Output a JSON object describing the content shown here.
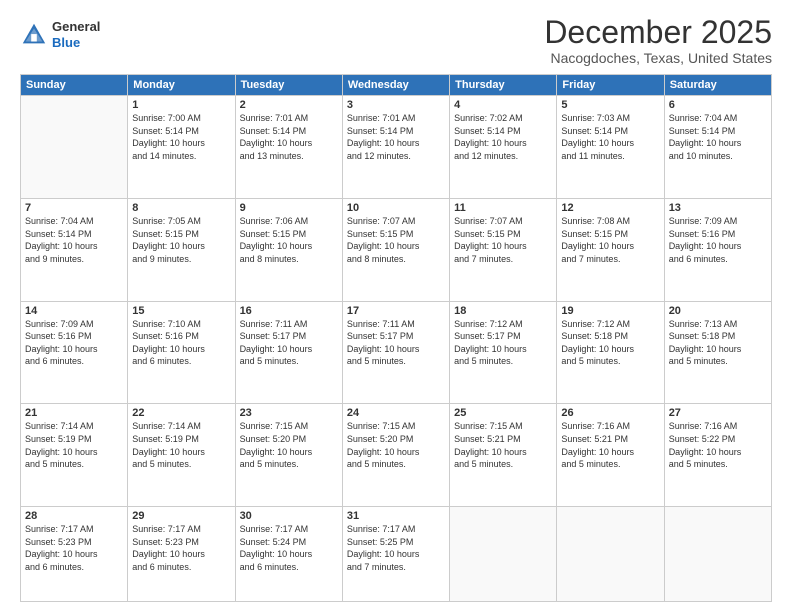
{
  "logo": {
    "general": "General",
    "blue": "Blue"
  },
  "header": {
    "month": "December 2025",
    "location": "Nacogdoches, Texas, United States"
  },
  "days_of_week": [
    "Sunday",
    "Monday",
    "Tuesday",
    "Wednesday",
    "Thursday",
    "Friday",
    "Saturday"
  ],
  "weeks": [
    [
      {
        "day": "",
        "info": ""
      },
      {
        "day": "1",
        "info": "Sunrise: 7:00 AM\nSunset: 5:14 PM\nDaylight: 10 hours\nand 14 minutes."
      },
      {
        "day": "2",
        "info": "Sunrise: 7:01 AM\nSunset: 5:14 PM\nDaylight: 10 hours\nand 13 minutes."
      },
      {
        "day": "3",
        "info": "Sunrise: 7:01 AM\nSunset: 5:14 PM\nDaylight: 10 hours\nand 12 minutes."
      },
      {
        "day": "4",
        "info": "Sunrise: 7:02 AM\nSunset: 5:14 PM\nDaylight: 10 hours\nand 12 minutes."
      },
      {
        "day": "5",
        "info": "Sunrise: 7:03 AM\nSunset: 5:14 PM\nDaylight: 10 hours\nand 11 minutes."
      },
      {
        "day": "6",
        "info": "Sunrise: 7:04 AM\nSunset: 5:14 PM\nDaylight: 10 hours\nand 10 minutes."
      }
    ],
    [
      {
        "day": "7",
        "info": "Sunrise: 7:04 AM\nSunset: 5:14 PM\nDaylight: 10 hours\nand 9 minutes."
      },
      {
        "day": "8",
        "info": "Sunrise: 7:05 AM\nSunset: 5:15 PM\nDaylight: 10 hours\nand 9 minutes."
      },
      {
        "day": "9",
        "info": "Sunrise: 7:06 AM\nSunset: 5:15 PM\nDaylight: 10 hours\nand 8 minutes."
      },
      {
        "day": "10",
        "info": "Sunrise: 7:07 AM\nSunset: 5:15 PM\nDaylight: 10 hours\nand 8 minutes."
      },
      {
        "day": "11",
        "info": "Sunrise: 7:07 AM\nSunset: 5:15 PM\nDaylight: 10 hours\nand 7 minutes."
      },
      {
        "day": "12",
        "info": "Sunrise: 7:08 AM\nSunset: 5:15 PM\nDaylight: 10 hours\nand 7 minutes."
      },
      {
        "day": "13",
        "info": "Sunrise: 7:09 AM\nSunset: 5:16 PM\nDaylight: 10 hours\nand 6 minutes."
      }
    ],
    [
      {
        "day": "14",
        "info": "Sunrise: 7:09 AM\nSunset: 5:16 PM\nDaylight: 10 hours\nand 6 minutes."
      },
      {
        "day": "15",
        "info": "Sunrise: 7:10 AM\nSunset: 5:16 PM\nDaylight: 10 hours\nand 6 minutes."
      },
      {
        "day": "16",
        "info": "Sunrise: 7:11 AM\nSunset: 5:17 PM\nDaylight: 10 hours\nand 5 minutes."
      },
      {
        "day": "17",
        "info": "Sunrise: 7:11 AM\nSunset: 5:17 PM\nDaylight: 10 hours\nand 5 minutes."
      },
      {
        "day": "18",
        "info": "Sunrise: 7:12 AM\nSunset: 5:17 PM\nDaylight: 10 hours\nand 5 minutes."
      },
      {
        "day": "19",
        "info": "Sunrise: 7:12 AM\nSunset: 5:18 PM\nDaylight: 10 hours\nand 5 minutes."
      },
      {
        "day": "20",
        "info": "Sunrise: 7:13 AM\nSunset: 5:18 PM\nDaylight: 10 hours\nand 5 minutes."
      }
    ],
    [
      {
        "day": "21",
        "info": "Sunrise: 7:14 AM\nSunset: 5:19 PM\nDaylight: 10 hours\nand 5 minutes."
      },
      {
        "day": "22",
        "info": "Sunrise: 7:14 AM\nSunset: 5:19 PM\nDaylight: 10 hours\nand 5 minutes."
      },
      {
        "day": "23",
        "info": "Sunrise: 7:15 AM\nSunset: 5:20 PM\nDaylight: 10 hours\nand 5 minutes."
      },
      {
        "day": "24",
        "info": "Sunrise: 7:15 AM\nSunset: 5:20 PM\nDaylight: 10 hours\nand 5 minutes."
      },
      {
        "day": "25",
        "info": "Sunrise: 7:15 AM\nSunset: 5:21 PM\nDaylight: 10 hours\nand 5 minutes."
      },
      {
        "day": "26",
        "info": "Sunrise: 7:16 AM\nSunset: 5:21 PM\nDaylight: 10 hours\nand 5 minutes."
      },
      {
        "day": "27",
        "info": "Sunrise: 7:16 AM\nSunset: 5:22 PM\nDaylight: 10 hours\nand 5 minutes."
      }
    ],
    [
      {
        "day": "28",
        "info": "Sunrise: 7:17 AM\nSunset: 5:23 PM\nDaylight: 10 hours\nand 6 minutes."
      },
      {
        "day": "29",
        "info": "Sunrise: 7:17 AM\nSunset: 5:23 PM\nDaylight: 10 hours\nand 6 minutes."
      },
      {
        "day": "30",
        "info": "Sunrise: 7:17 AM\nSunset: 5:24 PM\nDaylight: 10 hours\nand 6 minutes."
      },
      {
        "day": "31",
        "info": "Sunrise: 7:17 AM\nSunset: 5:25 PM\nDaylight: 10 hours\nand 7 minutes."
      },
      {
        "day": "",
        "info": ""
      },
      {
        "day": "",
        "info": ""
      },
      {
        "day": "",
        "info": ""
      }
    ]
  ]
}
